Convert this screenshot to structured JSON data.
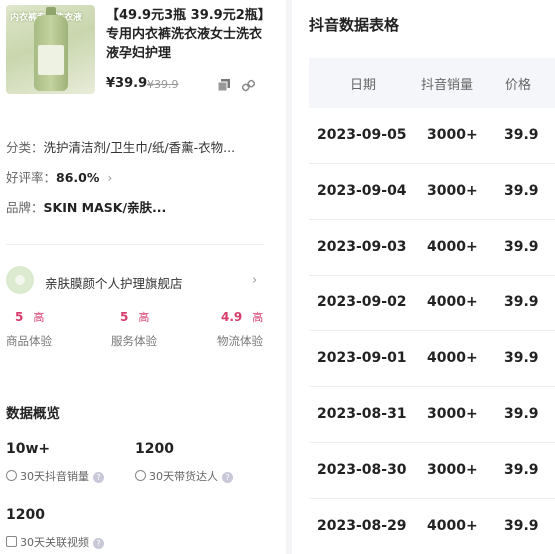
{
  "product": {
    "title": "【49.9元3瓶 39.9元2瓶】专用内衣裤洗衣液女士洗衣液孕妇护理",
    "price": "¥39.9",
    "price_old": "¥39.9",
    "image_text": "内衣裤专用洗衣液",
    "image_subtext": "洁净清爽 温和无刺激"
  },
  "info": {
    "category_label": "分类：",
    "category_value": "洗护清洁剂/卫生巾/纸/香薰-衣物...",
    "rating_label": "好评率：",
    "rating_value": "86.0%",
    "rating_chevron": "›",
    "brand_label": "品牌：",
    "brand_value": "SKIN MASK/亲肤..."
  },
  "store": {
    "name": "亲肤膜颜个人护理旗舰店",
    "chevron": "›",
    "scores": [
      {
        "value": "5",
        "level": "高",
        "label": "商品体验"
      },
      {
        "value": "5",
        "level": "高",
        "label": "服务体验"
      },
      {
        "value": "4.9",
        "level": "高",
        "label": "物流体验"
      }
    ]
  },
  "overview": {
    "title": "数据概览",
    "stats": [
      {
        "value": "10w+",
        "label": "30天抖音销量",
        "icon": "dollar-circle-icon"
      },
      {
        "value": "1200",
        "label": "30天带货达人",
        "icon": "person-circle-icon"
      },
      {
        "value": "1200",
        "label": "30天关联视频",
        "icon": "video-icon"
      }
    ],
    "help": "?"
  },
  "table": {
    "title": "抖音数据表格",
    "headers": [
      "日期",
      "抖音销量",
      "价格"
    ],
    "rows": [
      [
        "2023-09-05",
        "3000+",
        "39.9"
      ],
      [
        "2023-09-04",
        "3000+",
        "39.9"
      ],
      [
        "2023-09-03",
        "4000+",
        "39.9"
      ],
      [
        "2023-09-02",
        "4000+",
        "39.9"
      ],
      [
        "2023-09-01",
        "4000+",
        "39.9"
      ],
      [
        "2023-08-31",
        "3000+",
        "39.9"
      ],
      [
        "2023-08-30",
        "3000+",
        "39.9"
      ],
      [
        "2023-08-29",
        "4000+",
        "39.9"
      ]
    ]
  },
  "colors": {
    "score": "#d63d6b",
    "header_bg": "#f4f6fa"
  }
}
